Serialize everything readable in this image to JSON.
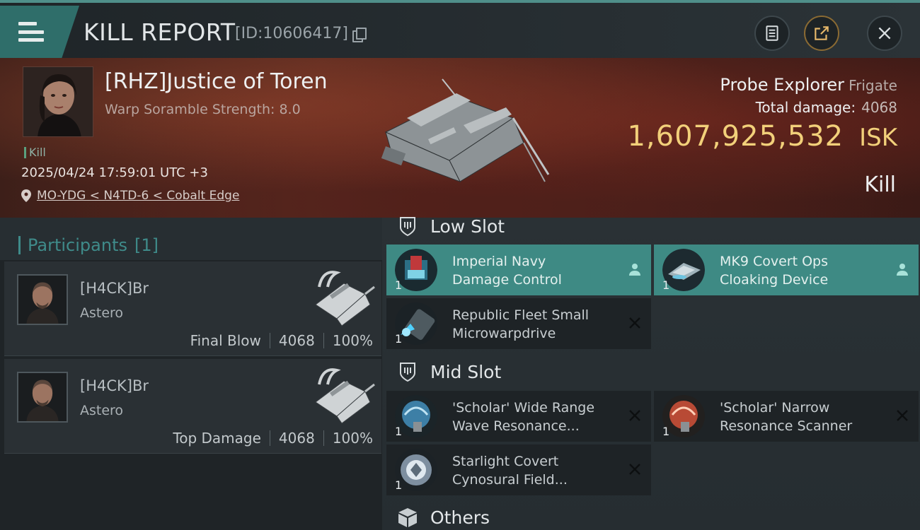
{
  "header": {
    "title": "KILL REPORT",
    "id_text": "[ID:10606417]"
  },
  "victim": {
    "name": "[RHZ]Justice of Toren",
    "warp_scramble": "Warp Soramble Strength: 8.0",
    "kill_tag": "Kill",
    "timestamp": "2025/04/24 17:59:01 UTC +3",
    "location": "MO-YDG < N4TD-6 < Cobalt Edge"
  },
  "ship": {
    "name": "Probe Explorer",
    "class": "Frigate",
    "total_damage_label": "Total damage:",
    "total_damage": "4068",
    "isk_value": "1,607,925,532",
    "isk_unit": "ISK",
    "outcome": "Kill"
  },
  "participants": {
    "label": "Participants",
    "count": "[1]",
    "items": [
      {
        "name": "[H4CK]Br",
        "ship": "Astero",
        "role": "Final Blow",
        "damage": "4068",
        "percent": "100%"
      },
      {
        "name": "[H4CK]Br",
        "ship": "Astero",
        "role": "Top Damage",
        "damage": "4068",
        "percent": "100%"
      }
    ]
  },
  "slots": {
    "low": {
      "title": "Low Slot",
      "items": [
        {
          "line1": "Imperial Navy",
          "line2": "Damage Control",
          "qty": "1",
          "state": "destroyed-dropped"
        },
        {
          "line1": "MK9 Covert Ops",
          "line2": "Cloaking Device",
          "qty": "1",
          "state": "destroyed-dropped"
        },
        {
          "line1": "Republic Fleet Small",
          "line2": "Microwarpdrive",
          "qty": "1",
          "state": "destroyed"
        }
      ]
    },
    "mid": {
      "title": "Mid Slot",
      "items": [
        {
          "line1": "'Scholar' Wide Range",
          "line2": "Wave Resonance...",
          "qty": "1",
          "state": "destroyed"
        },
        {
          "line1": "'Scholar' Narrow",
          "line2": "Resonance Scanner",
          "qty": "1",
          "state": "destroyed"
        },
        {
          "line1": "Starlight Covert",
          "line2": "Cynosural Field...",
          "qty": "1",
          "state": "destroyed"
        }
      ]
    },
    "others": {
      "title": "Others"
    }
  },
  "colors": {
    "accent_teal": "#3e8a84",
    "isk_gold": "#f2d07a",
    "hero_red": "#5a2a20"
  },
  "icons": [
    "menu-icon",
    "copy-icon",
    "clipboard-icon",
    "share-icon",
    "close-icon",
    "location-pin-icon",
    "shield-slot-icon",
    "box-icon",
    "person-icon",
    "x-icon"
  ]
}
